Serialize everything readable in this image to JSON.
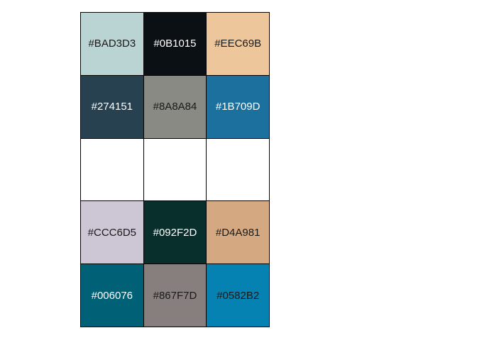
{
  "palette": {
    "swatches": [
      {
        "label": "#BAD3D3",
        "color": "#BAD3D3",
        "text_color": "#1a1a1a"
      },
      {
        "label": "#0B1015",
        "color": "#0B1015",
        "text_color": "#ffffff"
      },
      {
        "label": "#EEC69B",
        "color": "#EEC69B",
        "text_color": "#1a1a1a"
      },
      {
        "label": "#274151",
        "color": "#274151",
        "text_color": "#ffffff"
      },
      {
        "label": "#8A8A84",
        "color": "#8A8A84",
        "text_color": "#1a1a1a"
      },
      {
        "label": "#1B709D",
        "color": "#1B709D",
        "text_color": "#ffffff"
      },
      {
        "label": "",
        "color": "#FFFFFF",
        "text_color": "#1a1a1a"
      },
      {
        "label": "",
        "color": "#FFFFFF",
        "text_color": "#1a1a1a"
      },
      {
        "label": "",
        "color": "#FFFFFF",
        "text_color": "#1a1a1a"
      },
      {
        "label": "#CCC6D5",
        "color": "#CCC6D5",
        "text_color": "#1a1a1a"
      },
      {
        "label": "#092F2D",
        "color": "#092F2D",
        "text_color": "#ffffff"
      },
      {
        "label": "#D4A981",
        "color": "#D4A981",
        "text_color": "#1a1a1a"
      },
      {
        "label": "#006076",
        "color": "#006076",
        "text_color": "#ffffff"
      },
      {
        "label": "#867F7D",
        "color": "#867F7D",
        "text_color": "#1a1a1a"
      },
      {
        "label": "#0582B2",
        "color": "#0582B2",
        "text_color": "#1a1a1a"
      }
    ]
  }
}
